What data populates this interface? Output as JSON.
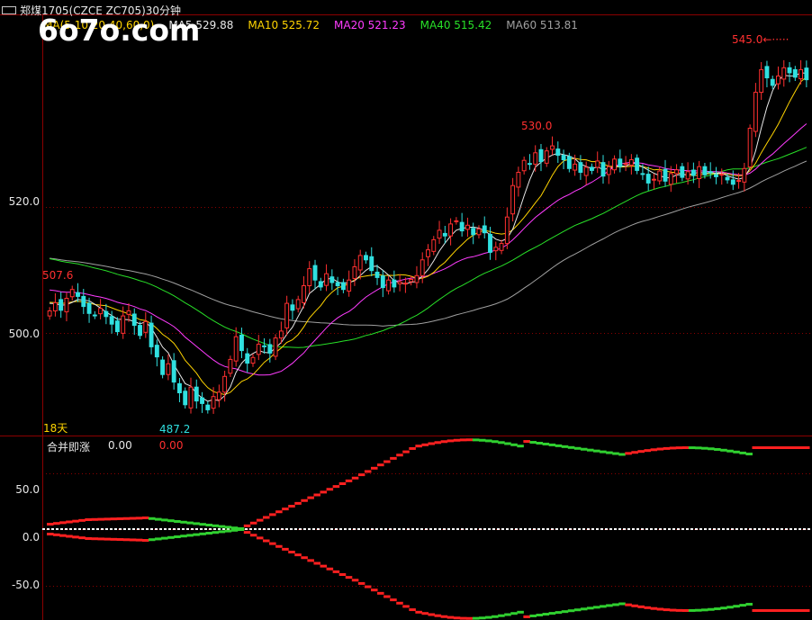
{
  "header": {
    "title": "郑煤1705(CZCE ZC705)30分钟"
  },
  "logo_text": "6o7o.com",
  "ma_legend": {
    "prefix": "MA(5,10,20,40,60,0)",
    "items": [
      {
        "label": "MA5 529.88",
        "color": "#e8e8e8"
      },
      {
        "label": "MA10 525.72",
        "color": "#ffd400"
      },
      {
        "label": "MA20 521.23",
        "color": "#ff3cff"
      },
      {
        "label": "MA40 515.42",
        "color": "#28e028"
      },
      {
        "label": "MA60 513.81",
        "color": "#a0a0a0"
      }
    ]
  },
  "price_axis": [
    "520.0",
    "500.0"
  ],
  "period_label": "18天",
  "annotations": {
    "high": "545.0",
    "mid_high": "530.0",
    "left_high": "507.6",
    "low": "487.2"
  },
  "sub_legend": {
    "name": "合并即涨",
    "value1": "0.00",
    "value2": "0.00"
  },
  "sub_axis": [
    "50.0",
    "0.0",
    "-50.0"
  ],
  "colors": {
    "up": "#ff3030",
    "down": "#30e0e0",
    "grid": "#8b0000",
    "positive_series": "#ff2020",
    "negative_series": "#30d030"
  },
  "chart_data": [
    {
      "type": "candlestick",
      "title": "郑煤1705(CZCE ZC705)30分钟",
      "ylim": [
        484,
        550
      ],
      "y_ticks": [
        520,
        500
      ],
      "closes": [
        503.5,
        504.8,
        503.6,
        505.5,
        506.9,
        505.8,
        504.2,
        503.1,
        502.8,
        503.9,
        502.6,
        501.4,
        500.2,
        502.7,
        503.5,
        501.2,
        499.6,
        501.8,
        497.8,
        496.2,
        493.4,
        495.1,
        492.2,
        490.5,
        488.6,
        491.4,
        489.2,
        488.8,
        487.8,
        489.9,
        490.6,
        493.1,
        495.8,
        499.4,
        497.2,
        495.2,
        496.1,
        498.2,
        497.9,
        496.8,
        499.2,
        500.3,
        504.7,
        503.6,
        505.3,
        507.5,
        510.2,
        508.4,
        507.3,
        509.4,
        508.0,
        507.5,
        506.9,
        508.4,
        510.5,
        512.3,
        511.6,
        509.9,
        508.8,
        507.2,
        508.4,
        507.3,
        508.1,
        507.9,
        508.5,
        509.1,
        511.6,
        513.2,
        514.8,
        516.3,
        515.4,
        517.3,
        517.8,
        516.2,
        517.1,
        515.6,
        516.5,
        515.9,
        512.8,
        513.6,
        514.2,
        518.4,
        523.4,
        525.5,
        527.4,
        526.8,
        528.6,
        527.2,
        528.9,
        529.7,
        528.2,
        527.5,
        526.1,
        526.8,
        525.5,
        526.3,
        525.8,
        527.3,
        524.9,
        526.4,
        527.6,
        526.4,
        526.9,
        527.5,
        525.8,
        525.2,
        523.8,
        524.4,
        525.7,
        524.1,
        525.3,
        525.9,
        524.7,
        525.6,
        525.0,
        526.4,
        525.1,
        525.4,
        524.8,
        525.2,
        524.3,
        523.6,
        524.2,
        526.1,
        532.5,
        538.2,
        541.8,
        540.5,
        539.3,
        540.8,
        542.1,
        541.3,
        540.6,
        541.8,
        540.2
      ],
      "ma_series": [
        {
          "name": "MA5",
          "value": 529.88
        },
        {
          "name": "MA10",
          "value": 525.72
        },
        {
          "name": "MA20",
          "value": 521.23
        },
        {
          "name": "MA40",
          "value": 515.42
        },
        {
          "name": "MA60",
          "value": 513.81
        }
      ],
      "annotated_points": {
        "high": 545.0,
        "mid_high": 530.0,
        "left_high": 507.6,
        "low": 487.2
      }
    },
    {
      "type": "line",
      "title": "合并即涨",
      "ylim": [
        -80,
        80
      ],
      "y_ticks": [
        50,
        0,
        -50
      ],
      "series": [
        {
          "name": "合并即涨",
          "values": [
            0.0
          ]
        }
      ],
      "upper_band_end_value": 72,
      "lower_band_end_value": -72
    }
  ]
}
